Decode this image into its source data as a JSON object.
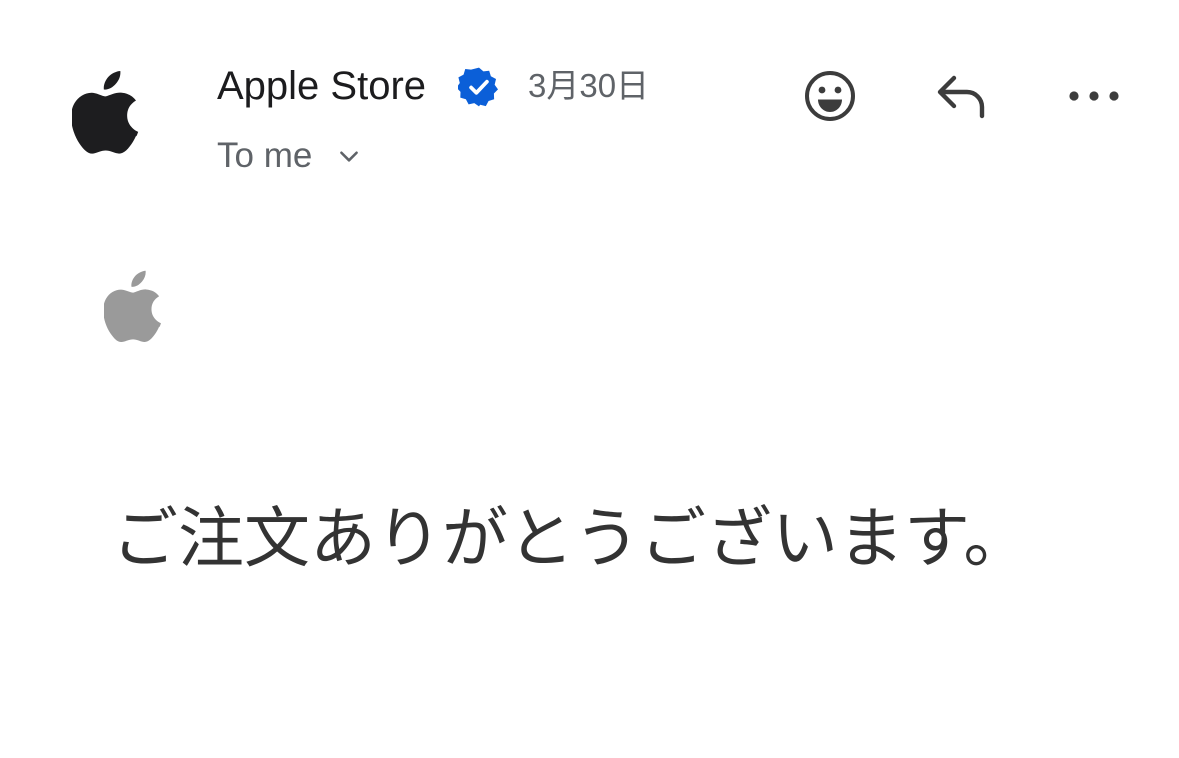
{
  "sender": {
    "name": "Apple Store",
    "avatar_icon": "apple-logo-icon",
    "verified_icon": "verified-badge-icon",
    "verified_color": "#0b5fd8"
  },
  "date": "3月30日",
  "recipient": {
    "label": "To me",
    "expand_icon": "chevron-down-icon"
  },
  "actions": {
    "emoji_icon": "smiley-icon",
    "reply_icon": "reply-icon",
    "more_icon": "more-horizontal-icon"
  },
  "body": {
    "logo_icon": "apple-logo-icon",
    "logo_color": "#9a9a9a",
    "heading": "ご注文ありがとうございます。"
  }
}
